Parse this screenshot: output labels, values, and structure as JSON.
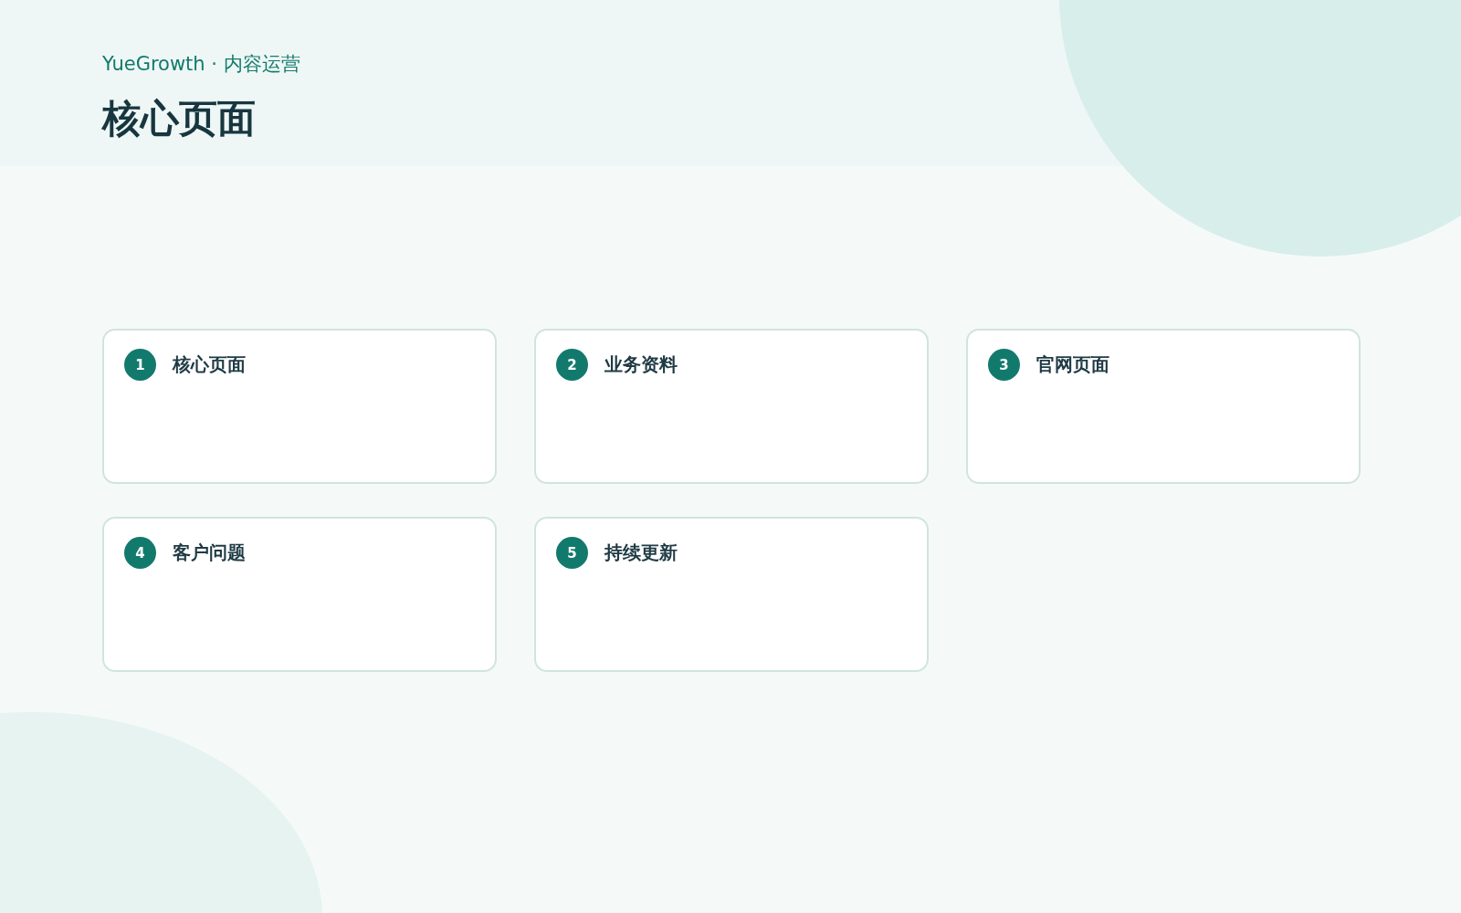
{
  "header": {
    "eyebrow": "YueGrowth · 内容运营",
    "title": "核心页面"
  },
  "cards": [
    {
      "number": "1",
      "title": "核心页面"
    },
    {
      "number": "2",
      "title": "业务资料"
    },
    {
      "number": "3",
      "title": "官网页面"
    },
    {
      "number": "4",
      "title": "客户问题"
    },
    {
      "number": "5",
      "title": "持续更新"
    }
  ]
}
